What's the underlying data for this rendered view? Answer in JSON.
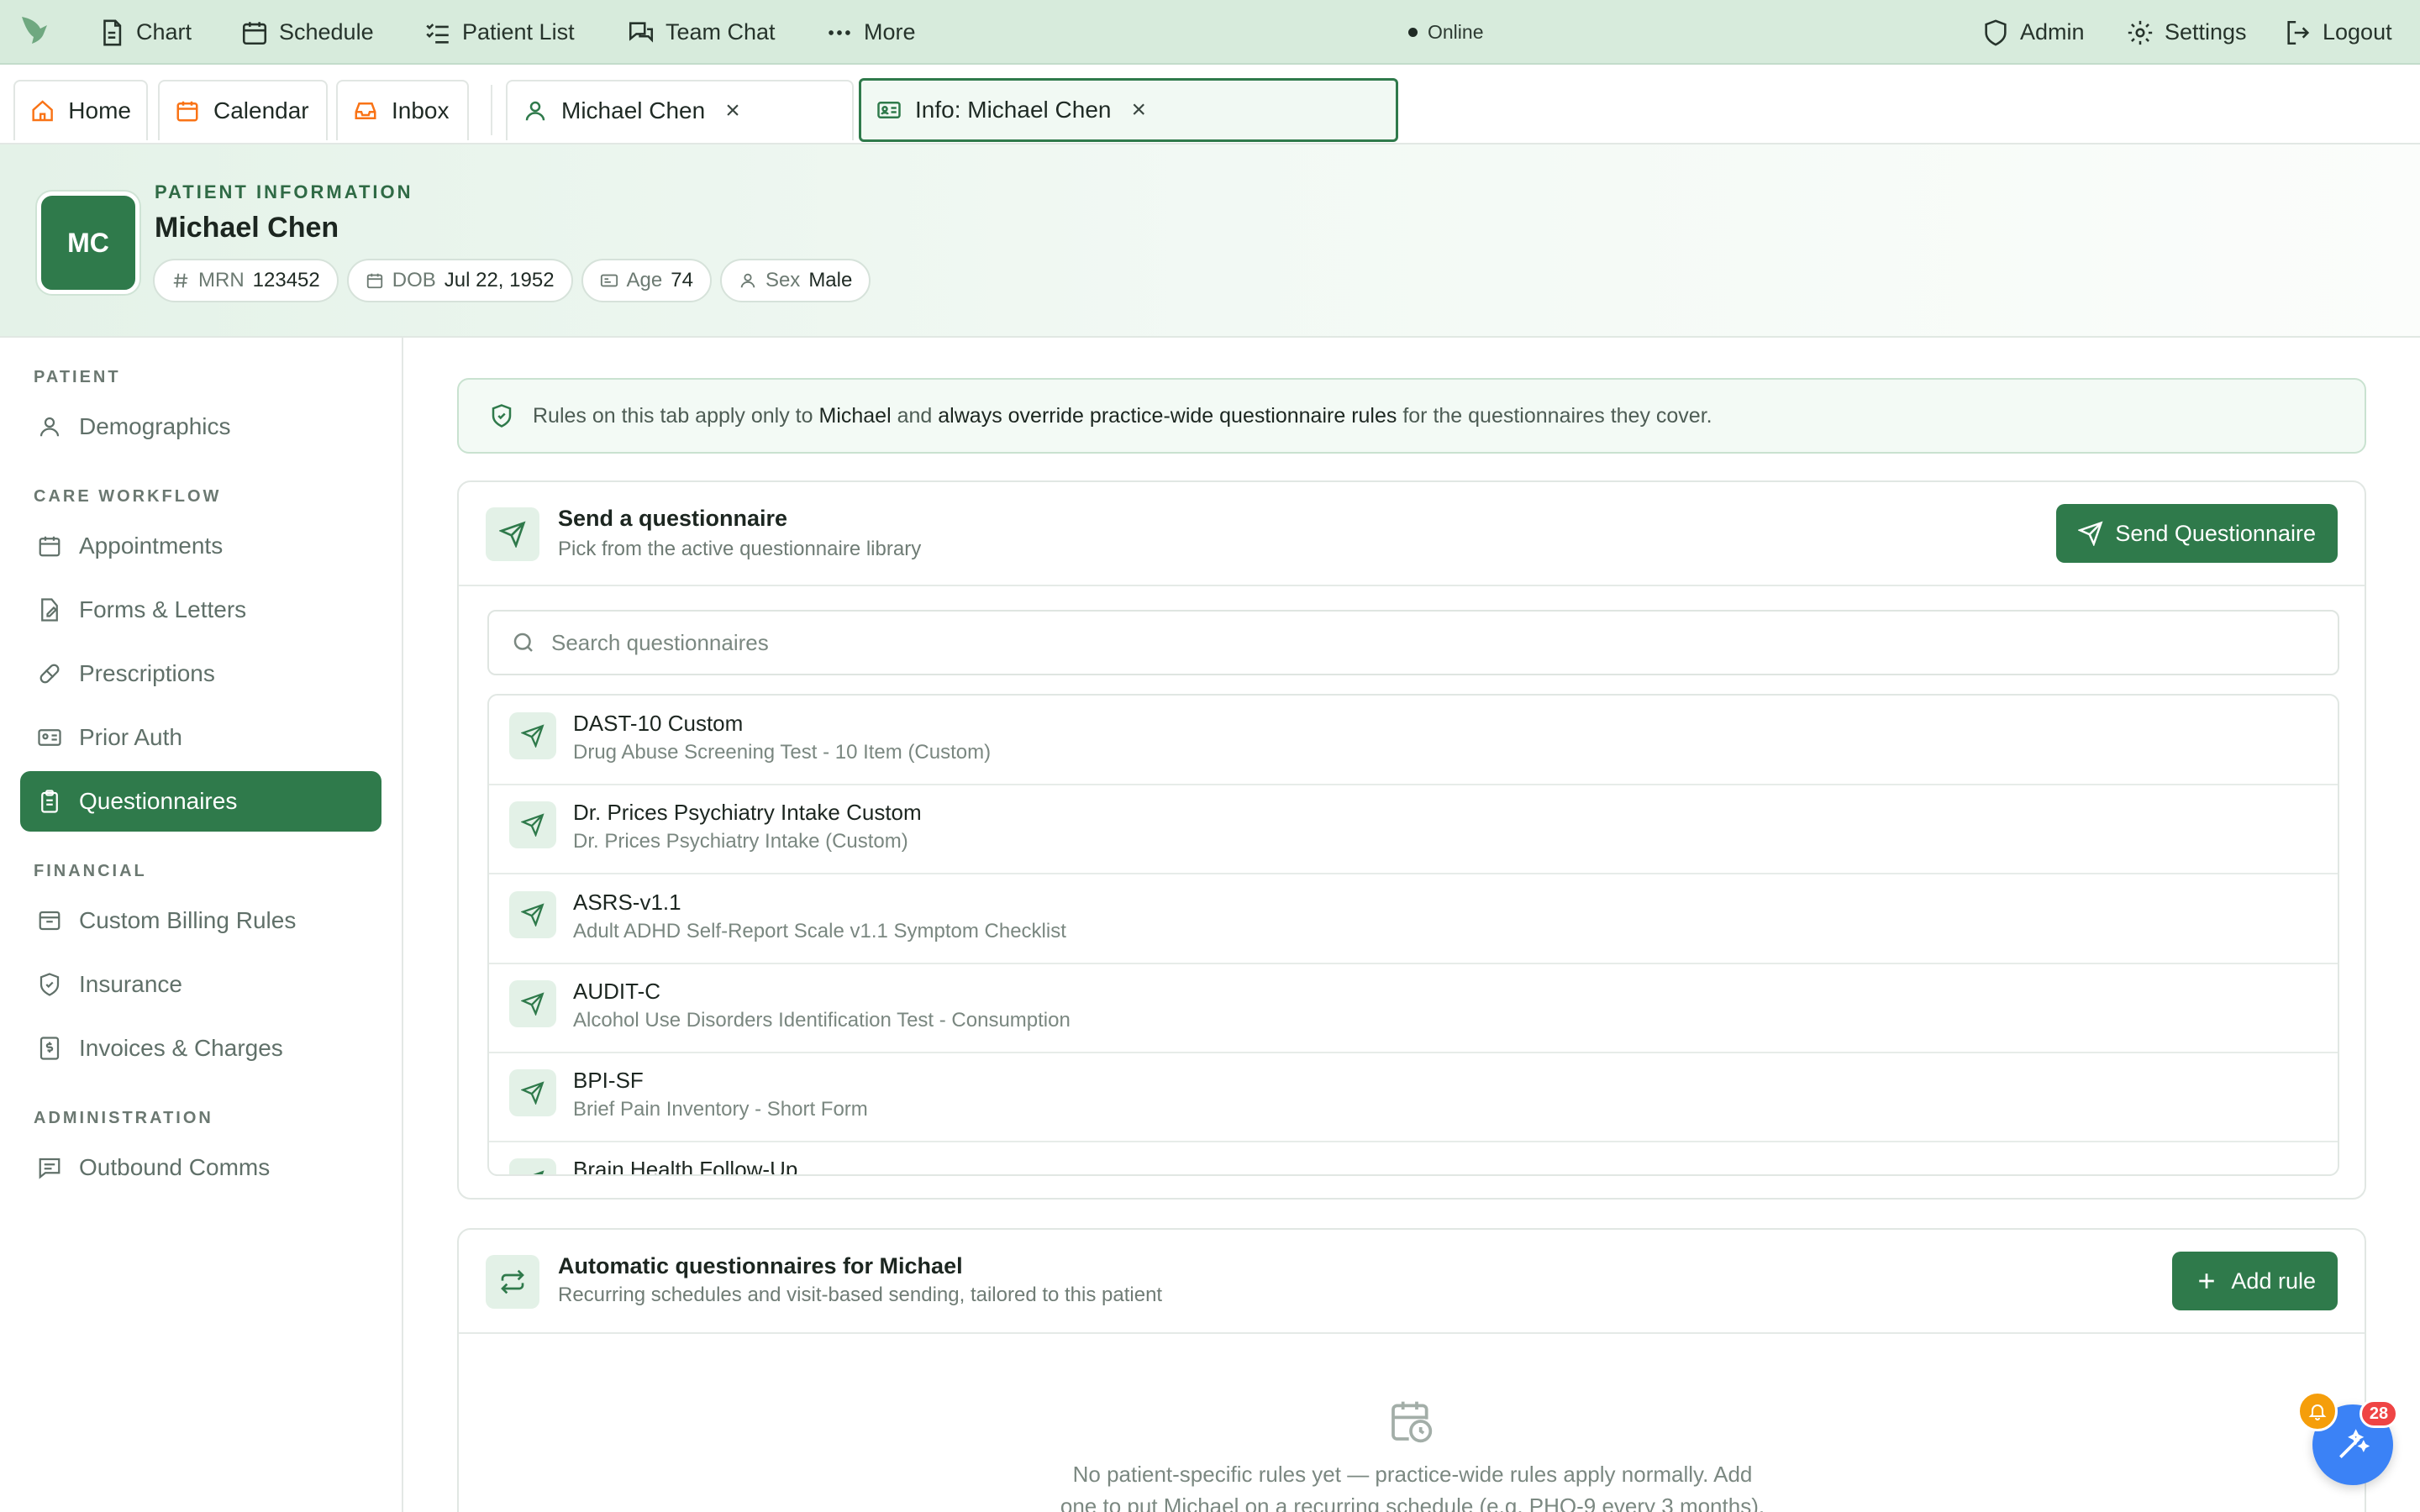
{
  "topnav": {
    "items": [
      {
        "label": "Chart",
        "icon": "document-icon"
      },
      {
        "label": "Schedule",
        "icon": "calendar-icon"
      },
      {
        "label": "Patient List",
        "icon": "list-icon"
      },
      {
        "label": "Team Chat",
        "icon": "chat-icon"
      },
      {
        "label": "More",
        "icon": "more-icon"
      }
    ],
    "status": "Online",
    "right": [
      {
        "label": "Admin",
        "icon": "shield-icon"
      },
      {
        "label": "Settings",
        "icon": "gear-icon"
      },
      {
        "label": "Logout",
        "icon": "logout-icon"
      }
    ]
  },
  "tabs": {
    "home": "Home",
    "calendar": "Calendar",
    "inbox": "Inbox",
    "patient": "Michael Chen",
    "info": "Info: Michael Chen",
    "close": "×"
  },
  "patient": {
    "eyebrow": "PATIENT INFORMATION",
    "initials": "MC",
    "name": "Michael Chen",
    "mrn_label": "MRN",
    "mrn": "123452",
    "dob_label": "DOB",
    "dob": "Jul 22, 1952",
    "age_label": "Age",
    "age": "74",
    "sex_label": "Sex",
    "sex": "Male"
  },
  "sidebar": {
    "sections": [
      "PATIENT",
      "CARE WORKFLOW",
      "FINANCIAL",
      "ADMINISTRATION"
    ],
    "items": [
      "Demographics",
      "Appointments",
      "Forms & Letters",
      "Prescriptions",
      "Prior Auth",
      "Questionnaires",
      "Custom Billing Rules",
      "Insurance",
      "Invoices & Charges",
      "Outbound Comms"
    ],
    "active": "Questionnaires"
  },
  "banner": {
    "pre": "Rules on this tab apply only to",
    "name": "Michael",
    "mid": "and",
    "strong": "always override practice-wide questionnaire rules",
    "post": "for the questionnaires they cover."
  },
  "send_card": {
    "title": "Send a questionnaire",
    "subtitle": "Pick from the active questionnaire library",
    "button": "Send Questionnaire",
    "search_placeholder": "Search questionnaires",
    "items": [
      {
        "title": "DAST-10 Custom",
        "subtitle": "Drug Abuse Screening Test - 10 Item (Custom)"
      },
      {
        "title": "Dr. Prices Psychiatry Intake Custom",
        "subtitle": "Dr. Prices Psychiatry Intake (Custom)"
      },
      {
        "title": "ASRS-v1.1",
        "subtitle": "Adult ADHD Self-Report Scale v1.1 Symptom Checklist"
      },
      {
        "title": "AUDIT-C",
        "subtitle": "Alcohol Use Disorders Identification Test - Consumption"
      },
      {
        "title": "BPI-SF",
        "subtitle": "Brief Pain Inventory - Short Form"
      },
      {
        "title": "Brain Health Follow-Up",
        "subtitle": ""
      }
    ]
  },
  "auto_card": {
    "title": "Automatic questionnaires for Michael",
    "subtitle": "Recurring schedules and visit-based sending, tailored to this patient",
    "button": "Add rule",
    "empty_line1": "No patient-specific rules yet — practice-wide rules apply normally. Add",
    "empty_line2": "one to put Michael on a recurring schedule (e.g. PHQ-9 every 3 months)."
  },
  "widget": {
    "badge": "28"
  },
  "colors": {
    "brand": "#2f7a4b",
    "nav_bg": "#d7ebdc",
    "accent_orange": "#f97316",
    "fab_blue": "#3b82f6",
    "badge_red": "#ef4444"
  }
}
